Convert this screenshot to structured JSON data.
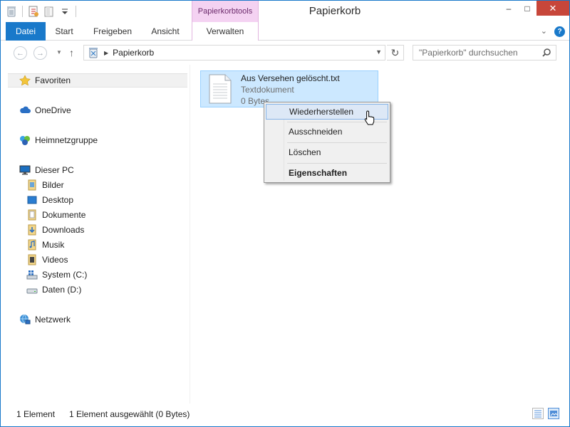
{
  "window": {
    "title": "Papierkorb",
    "contextual_group": "Papierkorbtools",
    "buttons": {
      "minimize": "–",
      "maximize": "□",
      "close": "✕"
    }
  },
  "ribbon": {
    "tabs": [
      {
        "label": "Datei",
        "active": true
      },
      {
        "label": "Start"
      },
      {
        "label": "Freigeben"
      },
      {
        "label": "Ansicht"
      },
      {
        "label": "Verwalten"
      }
    ],
    "help": "?"
  },
  "address": {
    "breadcrumb": "Papierkorb",
    "search_placeholder": "\"Papierkorb\" durchsuchen"
  },
  "nav": {
    "favorites": "Favoriten",
    "onedrive": "OneDrive",
    "homegroup": "Heimnetzgruppe",
    "this_pc": "Dieser PC",
    "pc_items": [
      "Bilder",
      "Desktop",
      "Dokumente",
      "Downloads",
      "Musik",
      "Videos",
      "System (C:)",
      "Daten (D:)"
    ],
    "network": "Netzwerk"
  },
  "file": {
    "name": "Aus Versehen gelöscht.txt",
    "type": "Textdokument",
    "size": "0 Bytes"
  },
  "context_menu": {
    "items": [
      "Wiederherstellen",
      "Ausschneiden",
      "Löschen",
      "Eigenschaften"
    ]
  },
  "status": {
    "count": "1 Element",
    "selection": "1 Element ausgewählt (0 Bytes)"
  },
  "colors": {
    "accent": "#1979ca",
    "contextual_tab": "#f4d2f2",
    "selection": "#cce8ff",
    "close_button": "#c7463a"
  }
}
